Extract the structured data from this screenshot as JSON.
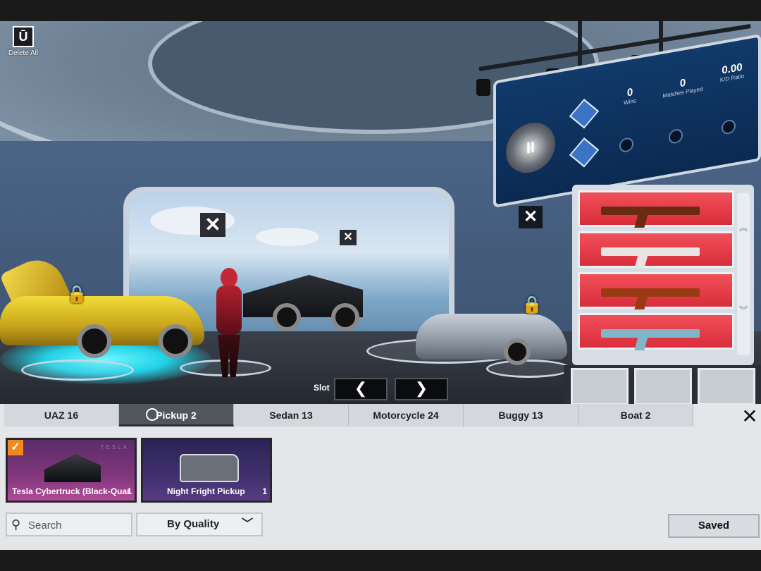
{
  "top_bar": {
    "delete_all_label": "Delete All"
  },
  "stats": {
    "wins": {
      "value": "0",
      "label": "Wins"
    },
    "matches": {
      "value": "0",
      "label": "Matches Played"
    },
    "kd": {
      "value": "0.00",
      "label": "K/D Ratio"
    },
    "tier_numeral": "II"
  },
  "navigation": {
    "slot_label": "Slot",
    "prev_glyph": "❮",
    "next_glyph": "❯"
  },
  "tabs": [
    {
      "label": "UAZ 16",
      "active": false
    },
    {
      "label": "Pickup 2",
      "active": true
    },
    {
      "label": "Sedan 13",
      "active": false
    },
    {
      "label": "Motorcycle 24",
      "active": false
    },
    {
      "label": "Buggy 13",
      "active": false
    },
    {
      "label": "Boat 2",
      "active": false
    }
  ],
  "vehicles": [
    {
      "name": "Tesla Cybertruck (Black-Quar",
      "count": "1",
      "brand": "TESLA",
      "selected": true
    },
    {
      "name": "Night Fright Pickup",
      "count": "1",
      "selected": false
    }
  ],
  "filters": {
    "search_placeholder": "Search",
    "sort_value": "By Quality"
  },
  "actions": {
    "saved_label": "Saved"
  },
  "colors": {
    "weapon_card": "#e03a45",
    "stats_panel": "#0f3663",
    "active_tab": "#51565d",
    "selected_check": "#f08a1c"
  },
  "icons": {
    "delete": "trash-icon",
    "close": "close-icon",
    "search": "search-icon",
    "lock": "lock-icon"
  }
}
